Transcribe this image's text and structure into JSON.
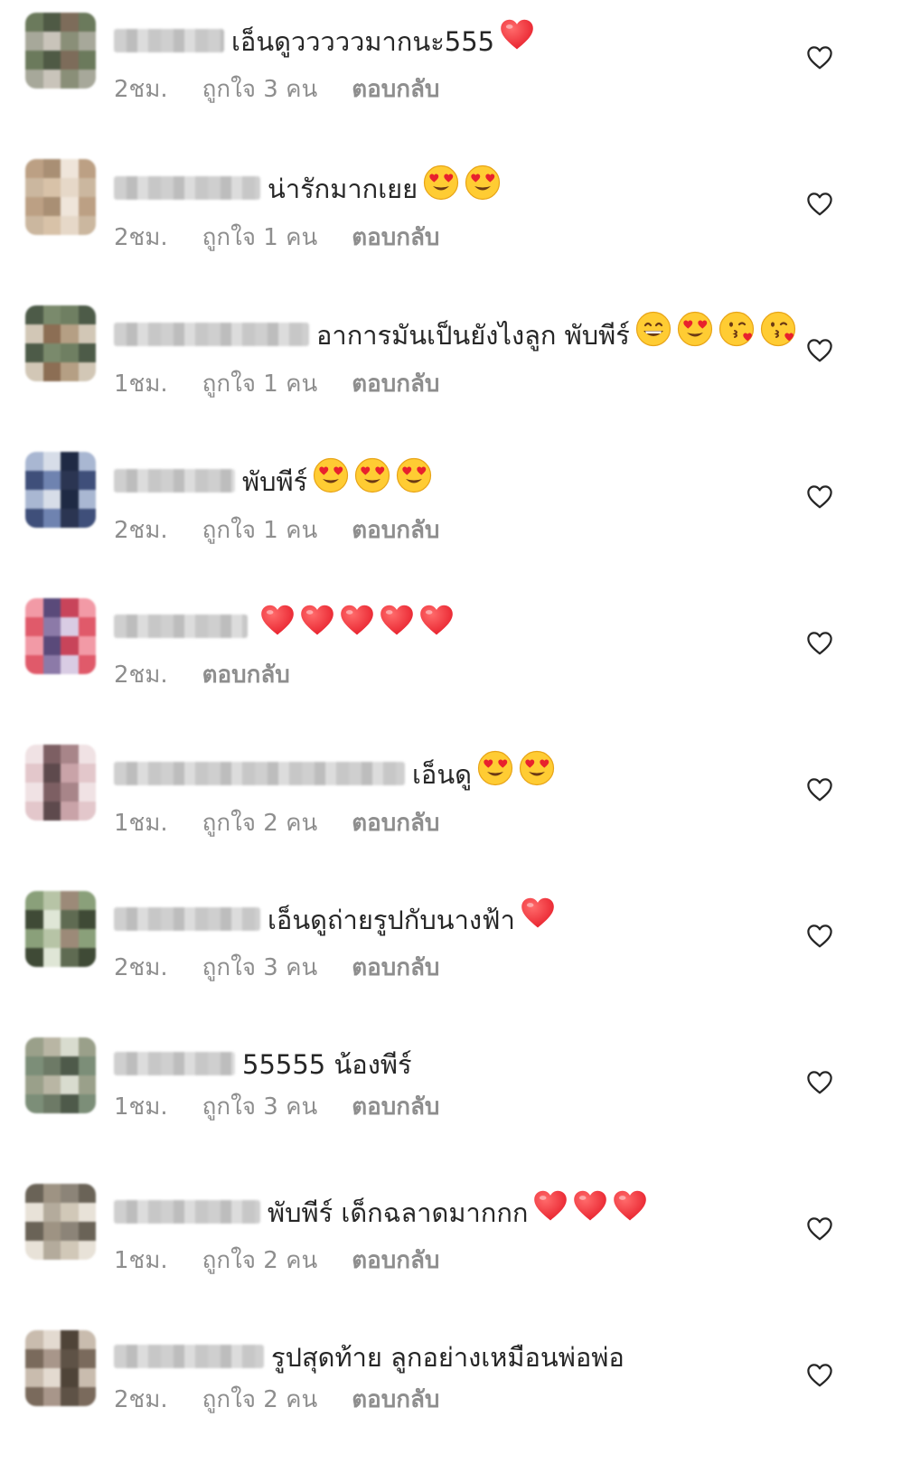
{
  "colors": {
    "text": "#262626",
    "meta": "#8e8e8e",
    "heart_red": "#e8212d"
  },
  "comments": [
    {
      "text": "เอ็นดูวววววมากนะ555",
      "emojis": [
        "red-heart"
      ],
      "time": "2ชม.",
      "likes": "ถูกใจ 3 คน",
      "reply": "ตอบกลับ"
    },
    {
      "text": "น่ารักมากเยย",
      "emojis": [
        "heart-eyes",
        "heart-eyes"
      ],
      "time": "2ชม.",
      "likes": "ถูกใจ 1 คน",
      "reply": "ตอบกลับ"
    },
    {
      "text": "อาการมันเป็นยังไงลูก พับพีร์",
      "emojis": [
        "grin",
        "heart-eyes",
        "kiss",
        "kiss"
      ],
      "time": "1ชม.",
      "likes": "ถูกใจ 1 คน",
      "reply": "ตอบกลับ"
    },
    {
      "text": "พับพีร์",
      "emojis": [
        "heart-eyes",
        "heart-eyes",
        "heart-eyes"
      ],
      "time": "2ชม.",
      "likes": "ถูกใจ 1 คน",
      "reply": "ตอบกลับ"
    },
    {
      "text": "",
      "emojis": [
        "red-heart",
        "red-heart",
        "red-heart",
        "red-heart",
        "red-heart"
      ],
      "time": "2ชม.",
      "likes": "",
      "reply": "ตอบกลับ"
    },
    {
      "text": "เอ็นดู",
      "emojis": [
        "heart-eyes",
        "heart-eyes"
      ],
      "time": "1ชม.",
      "likes": "ถูกใจ 2 คน",
      "reply": "ตอบกลับ"
    },
    {
      "text": "เอ็นดูถ่ายรูปกับนางฟ้า",
      "emojis": [
        "red-heart"
      ],
      "time": "2ชม.",
      "likes": "ถูกใจ 3 คน",
      "reply": "ตอบกลับ"
    },
    {
      "text": "55555 น้องพีร์",
      "emojis": [],
      "time": "1ชม.",
      "likes": "ถูกใจ 3 คน",
      "reply": "ตอบกลับ"
    },
    {
      "text": "พับพีร์ เด็กฉลาดมากกก",
      "emojis": [
        "red-heart",
        "red-heart",
        "red-heart"
      ],
      "time": "1ชม.",
      "likes": "ถูกใจ 2 คน",
      "reply": "ตอบกลับ"
    },
    {
      "text": "รูปสุดท้าย ลูกอย่างเหมือนพ่อพ่อ",
      "emojis": [],
      "time": "2ชม.",
      "likes": "ถูกใจ 2 คน",
      "reply": "ตอบกลับ"
    }
  ]
}
